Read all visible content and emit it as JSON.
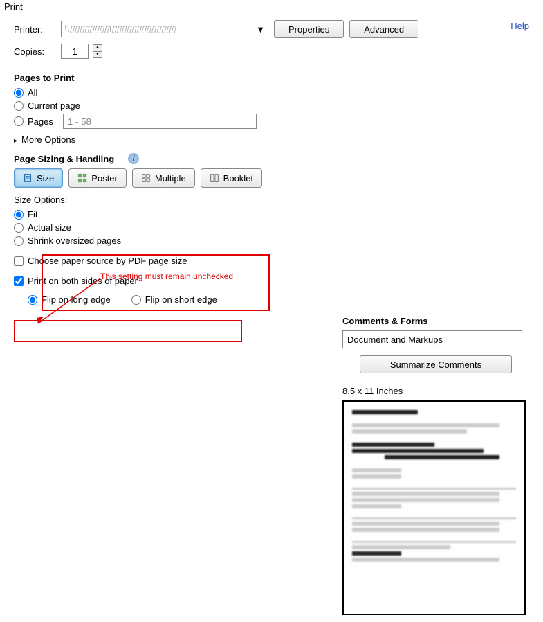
{
  "window": {
    "title": "Print"
  },
  "printer": {
    "label": "Printer:",
    "value": "\\\\▯▯▯▯▯▯▯▯\\▯▯▯▯▯▯▯▯▯▯▯▯▯",
    "properties_btn": "Properties",
    "advanced_btn": "Advanced"
  },
  "help": "Help",
  "copies": {
    "label": "Copies:",
    "value": "1"
  },
  "pages_to_print": {
    "title": "Pages to Print",
    "opts": {
      "all": "All",
      "current": "Current page",
      "pages": "Pages"
    },
    "pages_range": "1 - 58",
    "more": "More Options"
  },
  "sizing": {
    "title": "Page Sizing & Handling",
    "tabs": {
      "size": "Size",
      "poster": "Poster",
      "multiple": "Multiple",
      "booklet": "Booklet"
    },
    "size_options_label": "Size Options:",
    "opts": {
      "fit": "Fit",
      "actual": "Actual size",
      "shrink": "Shrink oversized pages"
    },
    "choose_paper": "Choose paper source by PDF page size",
    "both_sides": "Print on both sides of paper",
    "flip_long": "Flip on long edge",
    "flip_short": "Flip on short edge"
  },
  "comments": {
    "title": "Comments & Forms",
    "value": "Document and Markups",
    "summarize_btn": "Summarize Comments"
  },
  "preview": {
    "size_label": "8.5 x 11 Inches"
  },
  "annotation": {
    "text": "This setting must remain unchecked"
  }
}
